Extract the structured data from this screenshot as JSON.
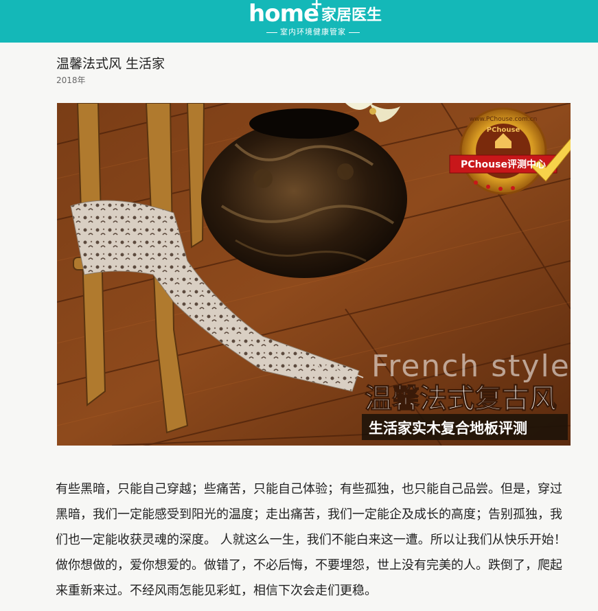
{
  "header": {
    "logo_main": "home",
    "logo_plus": "+",
    "logo_brand": "家居医生",
    "logo_tagline": "室内环境健康管家",
    "bg_color": "#14b8b8"
  },
  "article": {
    "title": "温馨法式风 生活家",
    "date": "2018年",
    "hero": {
      "stamp_text": "PChouse评测中心",
      "stamp_url": "www.PChouse.com.cn",
      "stamp_brand": "PChouse",
      "english_text": "French style",
      "headline": "温馨法式复古风",
      "subheadline": "生活家实木复合地板评测"
    },
    "paragraph": "有些黑暗，只能自己穿越；些痛苦，只能自己体验；有些孤独，也只能自己品尝。但是，穿过黑暗，我们一定能感受到阳光的温度；走出痛苦，我们一定能企及成长的高度；告别孤独，我们也一定能收获灵魂的深度。 人就这么一生，我们不能白来这一遭。所以让我们从快乐开始！做你想做的，爱你想爱的。做错了，不必后悔，不要埋怨，世上没有完美的人。跌倒了，爬起来重新来过。不经风雨怎能见彩虹，相信下次会走们更稳。"
  }
}
